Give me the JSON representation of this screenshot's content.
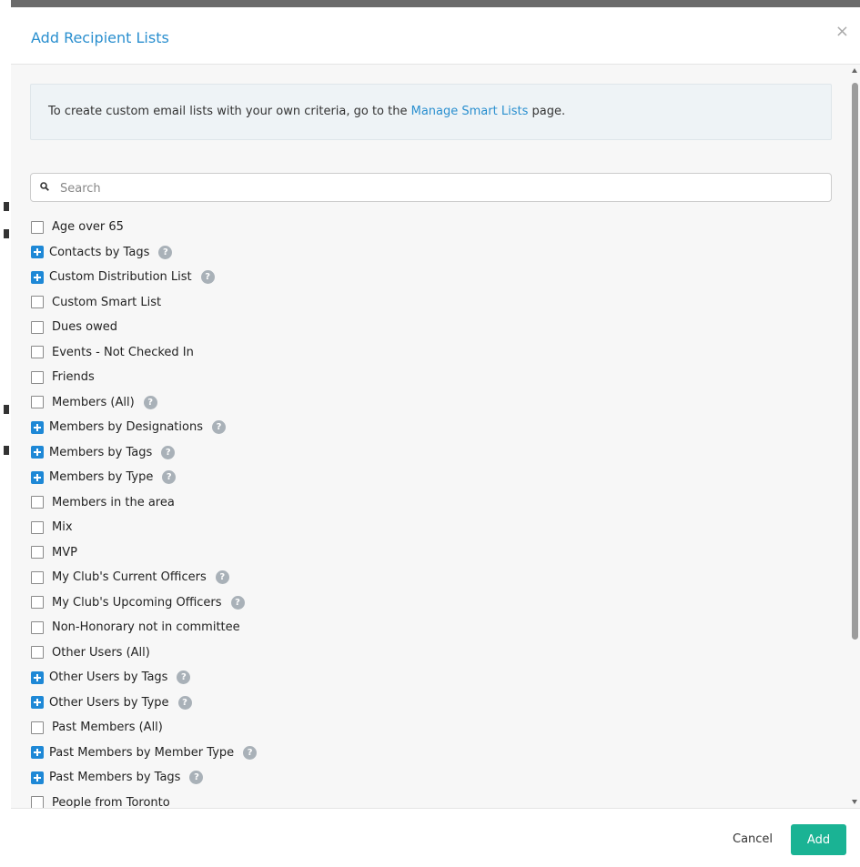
{
  "modal": {
    "title": "Add Recipient Lists",
    "close_label": "×"
  },
  "info": {
    "text_before": "To create custom email lists with your own criteria, go to the ",
    "link_text": "Manage Smart Lists",
    "text_after": " page."
  },
  "search": {
    "placeholder": "Search",
    "value": ""
  },
  "lists": [
    {
      "label": "Age over 65",
      "kind": "checkbox",
      "help": false
    },
    {
      "label": "Contacts by Tags",
      "kind": "expand",
      "help": true
    },
    {
      "label": "Custom Distribution List",
      "kind": "expand",
      "help": true
    },
    {
      "label": "Custom Smart List",
      "kind": "checkbox",
      "help": false
    },
    {
      "label": "Dues owed",
      "kind": "checkbox",
      "help": false
    },
    {
      "label": "Events - Not Checked In",
      "kind": "checkbox",
      "help": false
    },
    {
      "label": "Friends",
      "kind": "checkbox",
      "help": false
    },
    {
      "label": "Members (All)",
      "kind": "checkbox",
      "help": true
    },
    {
      "label": "Members by Designations",
      "kind": "expand",
      "help": true
    },
    {
      "label": "Members by Tags",
      "kind": "expand",
      "help": true
    },
    {
      "label": "Members by Type",
      "kind": "expand",
      "help": true
    },
    {
      "label": "Members in the area",
      "kind": "checkbox",
      "help": false
    },
    {
      "label": "Mix",
      "kind": "checkbox",
      "help": false
    },
    {
      "label": "MVP",
      "kind": "checkbox",
      "help": false
    },
    {
      "label": "My Club's Current Officers",
      "kind": "checkbox",
      "help": true
    },
    {
      "label": "My Club's Upcoming Officers",
      "kind": "checkbox",
      "help": true
    },
    {
      "label": "Non-Honorary not in committee",
      "kind": "checkbox",
      "help": false
    },
    {
      "label": "Other Users (All)",
      "kind": "checkbox",
      "help": false
    },
    {
      "label": "Other Users by Tags",
      "kind": "expand",
      "help": true
    },
    {
      "label": "Other Users by Type",
      "kind": "expand",
      "help": true
    },
    {
      "label": "Past Members (All)",
      "kind": "checkbox",
      "help": false
    },
    {
      "label": "Past Members by Member Type",
      "kind": "expand",
      "help": true
    },
    {
      "label": "Past Members by Tags",
      "kind": "expand",
      "help": true
    },
    {
      "label": "People from Toronto",
      "kind": "checkbox",
      "help": false
    }
  ],
  "help_glyph": "?",
  "footer": {
    "cancel_label": "Cancel",
    "add_label": "Add"
  },
  "colors": {
    "accent_blue": "#2a8fcf",
    "expand_blue": "#1e88d6",
    "add_green": "#1ab394",
    "help_gray": "#a9b1b8"
  }
}
